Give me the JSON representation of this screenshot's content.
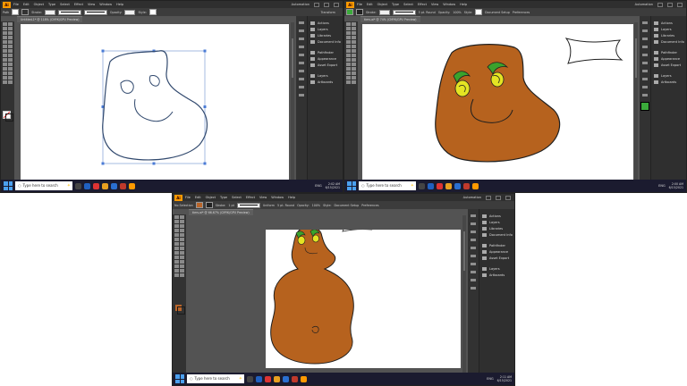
{
  "menu": [
    "File",
    "Edit",
    "Object",
    "Type",
    "Select",
    "Effect",
    "View",
    "Window",
    "Help"
  ],
  "app_logo": "Ai",
  "workspace": "Automation",
  "control_bar": {
    "path_label": "Path",
    "no_selection": "No Selection",
    "stroke_label": "Stroke:",
    "stroke_weight": "1 pt",
    "uniform": "Uniform",
    "brush": "5 pt. Round",
    "opacity_label": "Opacity:",
    "opacity_value": "100%",
    "style_label": "Style:",
    "transform_label": "Transform",
    "document_setup": "Document Setup",
    "preferences": "Preferences"
  },
  "doc_tabs": {
    "one": "Untitled-1* @ 118% (CMYK/GPU Preview)",
    "two": "tiers.ai* @ 74% (CMYK/GPU Preview)",
    "three": "tiers.ai* @ 66.67% (CMYK/GPU Preview)"
  },
  "panels": [
    "Actions",
    "Layers",
    "Libraries",
    "Document Info",
    "Pathfinder",
    "Appearance",
    "Asset Export",
    "Layers",
    "Artboards"
  ],
  "taskbar": {
    "search_placeholder": "Type here to search",
    "lang": "ENG",
    "time_1": "2:02 AM",
    "date_1": "6/15/2021",
    "time_2": "2:00 AM",
    "date_2": "6/15/2021",
    "time_3": "2:11 AM",
    "date_3": "6/15/2021"
  },
  "colors": {
    "brown": "#b6621e",
    "dark": "#1f1f1f",
    "leaf": "#3aa22c",
    "eye": "#e4e423",
    "fill_green": "#3bab3b",
    "fill_brown": "#b9652a",
    "outline_blue": "#31496e"
  }
}
